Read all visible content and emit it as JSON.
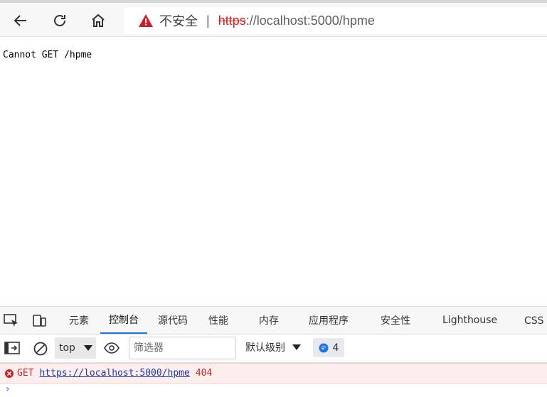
{
  "browser": {
    "security_label": "不安全",
    "separator": "|",
    "url_scheme": "https",
    "url_rest_host": "://localhost",
    "url_port_path": ":5000/hpme"
  },
  "page": {
    "message": "Cannot GET /hpme"
  },
  "devtools": {
    "tabs": [
      {
        "label": "元素"
      },
      {
        "label": "控制台"
      },
      {
        "label": "源代码"
      },
      {
        "label": "性能"
      },
      {
        "label": "内存"
      },
      {
        "label": "应用程序"
      },
      {
        "label": "安全性"
      },
      {
        "label": "Lighthouse"
      },
      {
        "label": "CSS 概"
      }
    ],
    "active_tab": "控制台",
    "context": "top",
    "filter_placeholder": "筛选器",
    "level_label": "默认级别",
    "message_count": "4",
    "error": {
      "method": "GET",
      "url": "https://localhost:5000/hpme",
      "status": "404"
    },
    "prompt": "›"
  },
  "colors": {
    "accent": "#1a73e8",
    "error": "#c52424",
    "warning": "#d32222"
  }
}
